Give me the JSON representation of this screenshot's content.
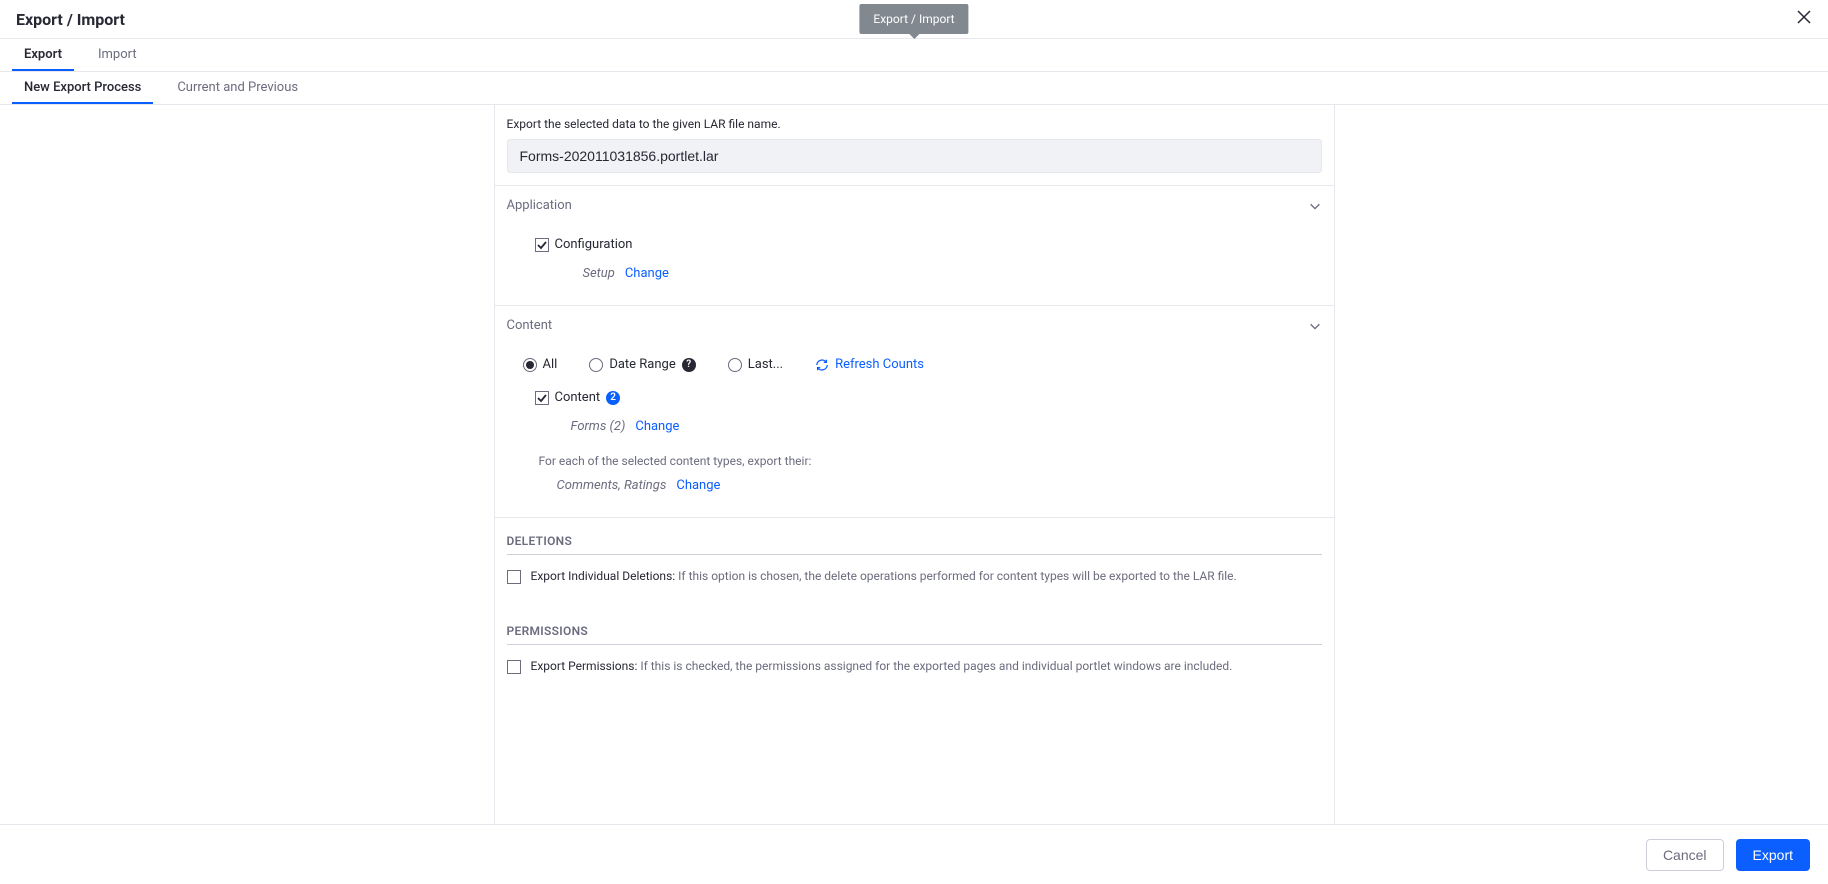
{
  "header": {
    "title": "Export / Import",
    "tooltip": "Export / Import"
  },
  "tabs": {
    "primary": [
      "Export",
      "Import"
    ],
    "secondary": [
      "New Export Process",
      "Current and Previous"
    ]
  },
  "intro": "Export the selected data to the given LAR file name.",
  "filename": "Forms-202011031856.portlet.lar",
  "application": {
    "title": "Application",
    "configuration": "Configuration",
    "setup_label": "Setup",
    "change": "Change"
  },
  "content": {
    "title": "Content",
    "radios": {
      "all": "All",
      "date_range": "Date Range",
      "last": "Last..."
    },
    "date_range_badge": "?",
    "refresh": "Refresh Counts",
    "content_label": "Content",
    "content_badge": "2",
    "forms_label": "Forms (2)",
    "change": "Change",
    "info": "For each of the selected content types, export their:",
    "comments_label": "Comments, Ratings",
    "change2": "Change"
  },
  "deletions": {
    "title": "DELETIONS",
    "lead": "Export Individual Deletions:",
    "desc": "If this option is chosen, the delete operations performed for content types will be exported to the LAR file."
  },
  "permissions": {
    "title": "PERMISSIONS",
    "lead": "Export Permissions:",
    "desc": "If this is checked, the permissions assigned for the exported pages and individual portlet windows are included."
  },
  "footer": {
    "cancel": "Cancel",
    "export": "Export"
  }
}
